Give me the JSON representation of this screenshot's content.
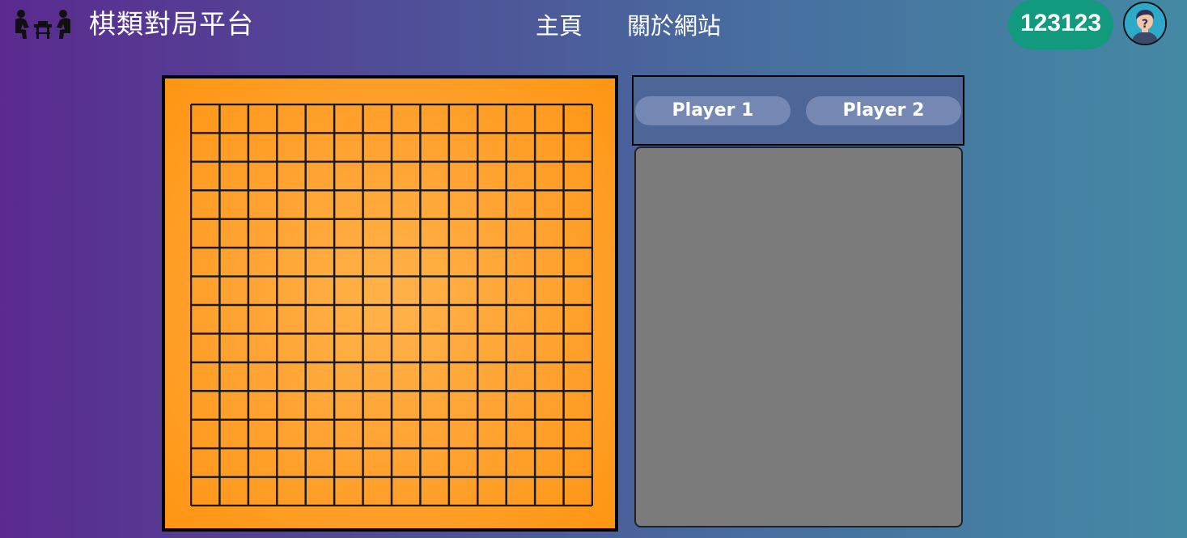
{
  "header": {
    "logo_icon": "chess-players-icon",
    "site_title": "棋類對局平台",
    "nav": [
      {
        "label": "主頁"
      },
      {
        "label": "關於網站"
      }
    ],
    "user_id": "123123",
    "avatar_icon": "user-avatar-icon"
  },
  "board": {
    "lines": 15,
    "color": "#ff9a1f",
    "line_color": "#1a1a1a"
  },
  "players": {
    "player1_label": "Player 1",
    "player2_label": "Player 2"
  },
  "colors": {
    "accent_green": "#119a7d",
    "panel_gray": "#7b7b7b"
  }
}
